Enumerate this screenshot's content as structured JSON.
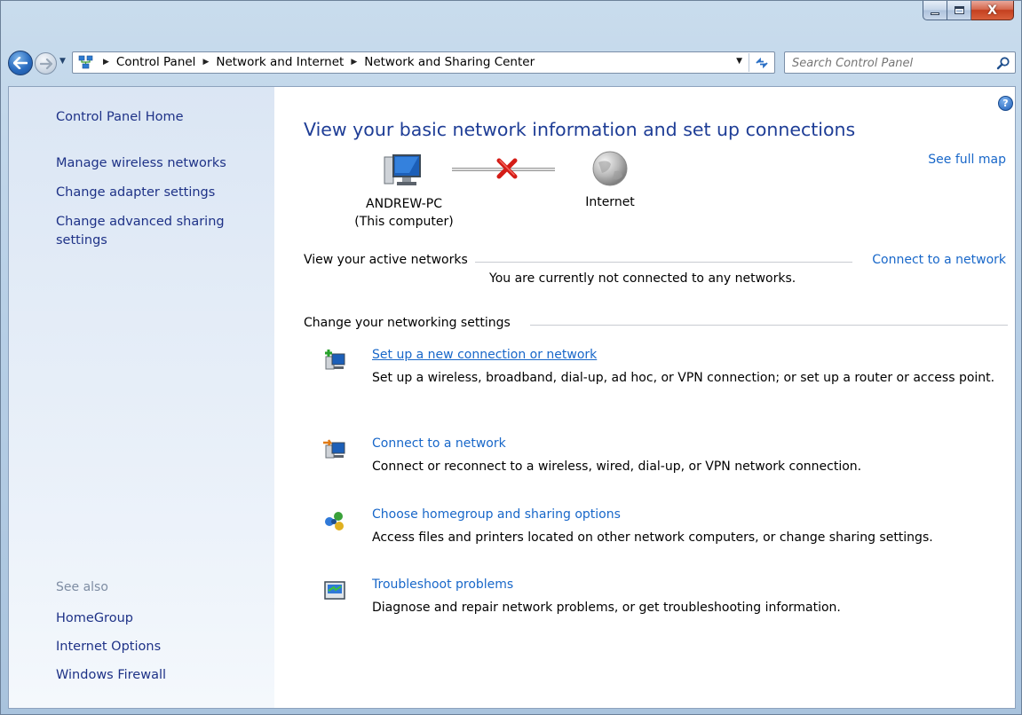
{
  "window": {
    "minimize_label": "minimize",
    "maximize_label": "maximize",
    "close_glyph": "X"
  },
  "navbar": {
    "back_icon": "back-arrow-icon",
    "forward_icon": "forward-arrow-icon",
    "breadcrumbs": [
      "Control Panel",
      "Network and Internet",
      "Network and Sharing Center"
    ],
    "search_placeholder": "Search Control Panel"
  },
  "sidebar": {
    "items": [
      {
        "label": "Control Panel Home"
      },
      {
        "label": "Manage wireless networks"
      },
      {
        "label": "Change adapter settings"
      },
      {
        "label": "Change advanced sharing settings"
      }
    ],
    "see_also_heading": "See also",
    "see_also": [
      {
        "label": "HomeGroup"
      },
      {
        "label": "Internet Options"
      },
      {
        "label": "Windows Firewall"
      }
    ]
  },
  "main": {
    "help_glyph": "?",
    "title": "View your basic network information and set up connections",
    "see_full_map": "See full map",
    "computer_name": "ANDREW-PC",
    "computer_sub": "(This computer)",
    "internet_label": "Internet",
    "active_networks_heading": "View your active networks",
    "connect_to_network": "Connect to a network",
    "not_connected": "You are currently not connected to any networks.",
    "change_settings_heading": "Change your networking settings",
    "tasks": [
      {
        "icon": "new-connection-icon",
        "label": "Set up a new connection or network",
        "desc": "Set up a wireless, broadband, dial-up, ad hoc, or VPN connection; or set up a router or access point."
      },
      {
        "icon": "connect-network-icon",
        "label": "Connect to a network",
        "desc": "Connect or reconnect to a wireless, wired, dial-up, or VPN network connection."
      },
      {
        "icon": "homegroup-icon",
        "label": "Choose homegroup and sharing options",
        "desc": "Access files and printers located on other network computers, or change sharing settings."
      },
      {
        "icon": "troubleshoot-icon",
        "label": "Troubleshoot problems",
        "desc": "Diagnose and repair network problems, or get troubleshooting information."
      }
    ]
  }
}
